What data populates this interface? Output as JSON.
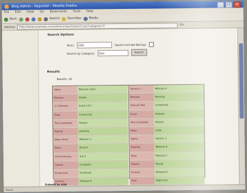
{
  "window": {
    "title": "Blog Admin - Reporter - Mozilla Firefox"
  },
  "menu": [
    "File",
    "Edit",
    "View",
    "Go",
    "Bookmarks",
    "Tools",
    "Help"
  ],
  "toolbar": {
    "back": "Back",
    "search": "Search",
    "favorites": "Favorites",
    "media": "Media"
  },
  "address": {
    "label": "Address",
    "url": "http://www.example.com/admin/report/search.jsp?category=2",
    "go": "Go"
  },
  "form": {
    "section": "Search Options",
    "keyword_label": "Term:",
    "keyword_value": "ENG",
    "include_label": "Search Include Backup",
    "category_label": "Search by Category:",
    "category_value": "Stat",
    "search_button": "Search"
  },
  "results": {
    "heading": "Results",
    "count": "Results: 16"
  },
  "table": {
    "left": [
      {
        "k": "alpha",
        "v": "Release notes"
      },
      {
        "k": "Release",
        "v": "Stable"
      },
      {
        "k": "1.2 Release",
        "v": "build 3.4.2"
      },
      {
        "k": "Repo",
        "v": "Connected"
      },
      {
        "k": "Test Candidate",
        "v": "Passed"
      },
      {
        "k": "Nightly",
        "v": "pending"
      },
      {
        "k": "Alpha Build",
        "v": "Release 3"
      },
      {
        "k": "Repo",
        "v": "Branch"
      },
      {
        "k": "Client Version",
        "v": "4.6.5"
      },
      {
        "k": "Upload",
        "v": "Complete"
      },
      {
        "k": "Production",
        "v": "Published"
      },
      {
        "k": "Archive",
        "v": "Release A"
      }
    ],
    "right": [
      {
        "k": "Version 1",
        "v": "Release A"
      },
      {
        "k": "Release",
        "v": "Pending"
      },
      {
        "k": "Feature Test",
        "v": "Completed"
      },
      {
        "k": "Build",
        "v": "Release"
      },
      {
        "k": "Test Candidate",
        "v": "Passed"
      },
      {
        "k": "Repo",
        "v": "build"
      },
      {
        "k": "Alpha",
        "v": "Version 3"
      },
      {
        "k": "Staging",
        "v": "Release B"
      },
      {
        "k": "Beta",
        "v": "Release C"
      },
      {
        "k": "Deploy",
        "v": "Ready"
      },
      {
        "k": "Archive",
        "v": "Release D"
      },
      {
        "k": "Final",
        "v": "Approved"
      }
    ]
  },
  "footer": {
    "section": "Submit to site"
  },
  "status": {
    "text": "Done"
  }
}
